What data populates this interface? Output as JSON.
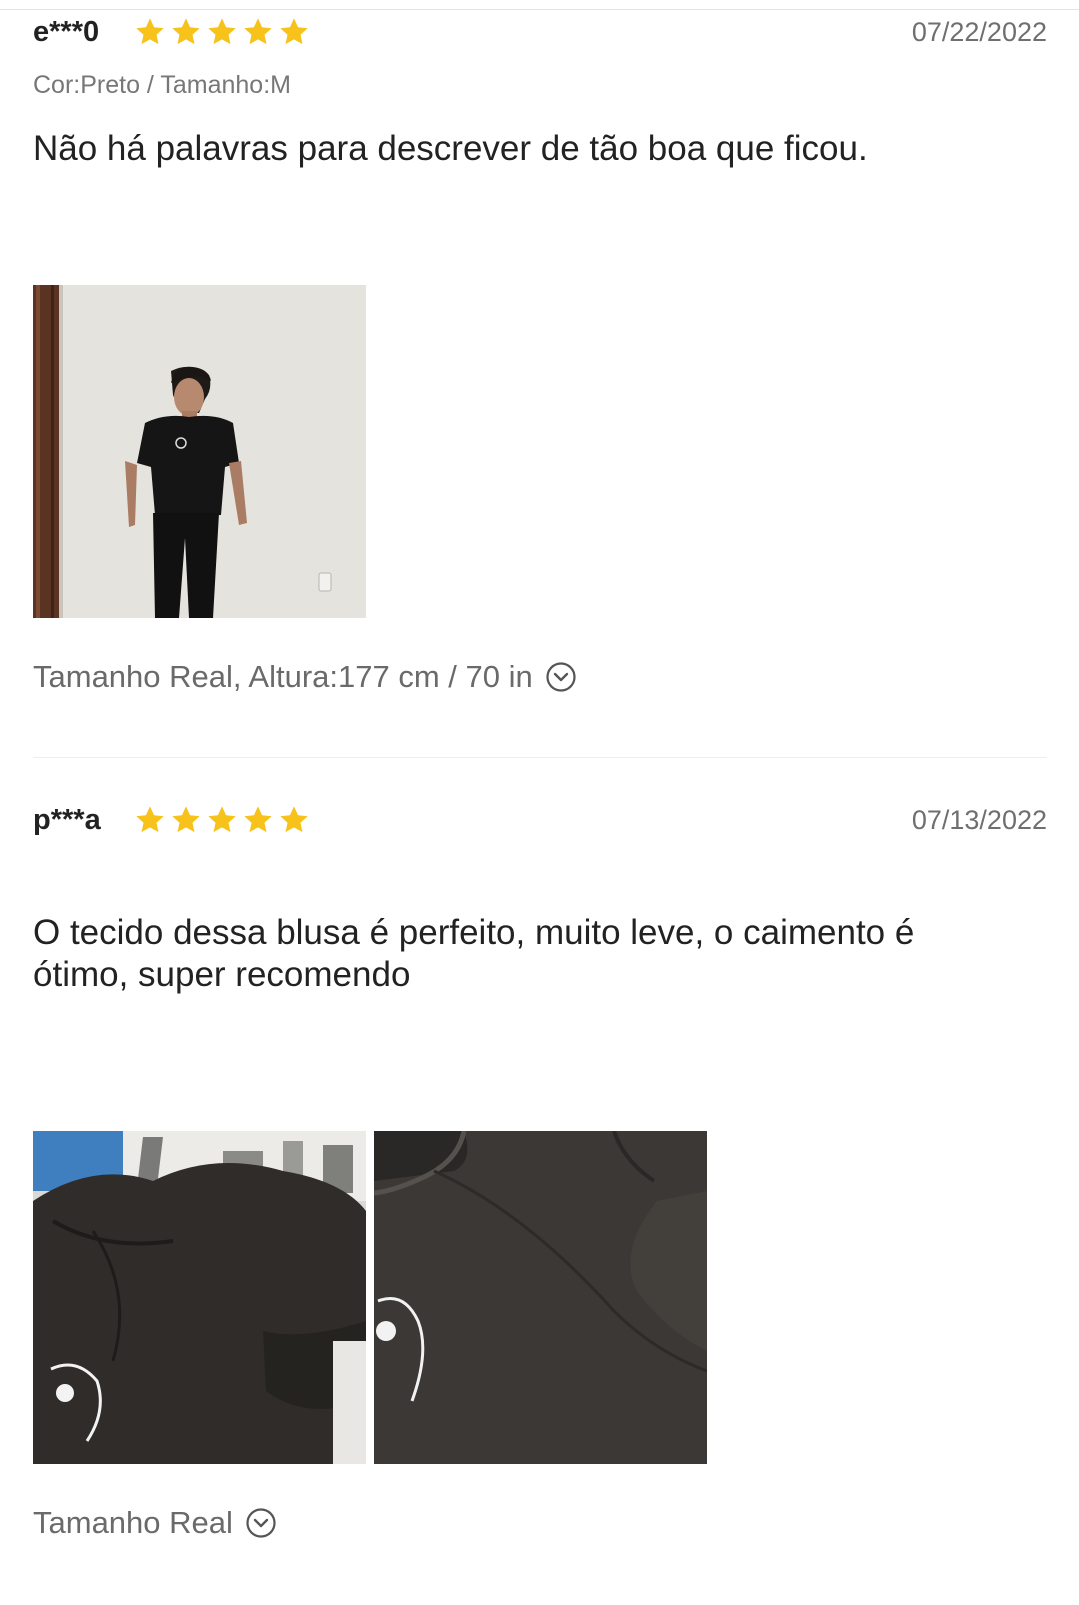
{
  "reviews": [
    {
      "username": "e***0",
      "rating": 5,
      "date": "07/22/2022",
      "variant": "Cor:Preto / Tamanho:M",
      "text": "Não há palavras para descrever de tão boa que ficou.",
      "photos": [
        "photo-man-black-tshirt"
      ],
      "fit": "Tamanho Real, Altura:177 cm / 70 in"
    },
    {
      "username": "p***a",
      "rating": 5,
      "date": "07/13/2022",
      "text": "O tecido dessa blusa é perfeito, muito leve, o caimento é ótimo, super recomendo",
      "photos": [
        "photo-shirt-flat",
        "photo-shirt-closeup"
      ],
      "fit": "Tamanho Real"
    }
  ],
  "icons": {
    "star": "star-icon",
    "fit_toggle": "chevron-circle-down-icon"
  },
  "colors": {
    "star": "#f7c21a",
    "muted_text": "#6a6a6a",
    "text": "#222222"
  }
}
